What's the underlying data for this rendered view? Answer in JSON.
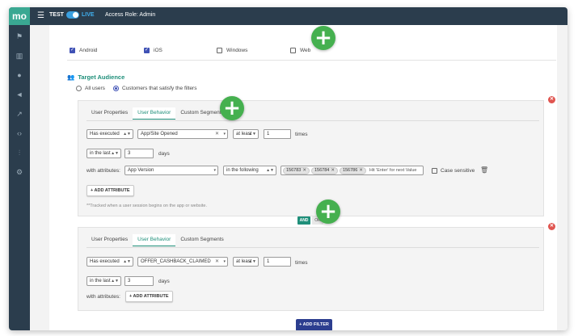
{
  "topbar": {
    "logo": "mo",
    "env_test": "TEST",
    "env_live": "LIVE",
    "access_role": "Access Role: Admin"
  },
  "sidebar": {
    "icons": [
      "flag-icon",
      "bar-chart-icon",
      "users-icon",
      "megaphone-icon",
      "trend-chart-icon",
      "code-icon",
      "sliders-icon",
      "gear-icon"
    ]
  },
  "platforms": [
    {
      "label": "Android",
      "checked": true
    },
    {
      "label": "iOS",
      "checked": true
    },
    {
      "label": "Windows",
      "checked": false
    },
    {
      "label": "Web",
      "checked": false
    }
  ],
  "target_audience": {
    "title": "Target Audience",
    "option_all": "All users",
    "option_filters": "Customers that satisfy the filters",
    "selected": "filters"
  },
  "filter1": {
    "tabs": [
      "User Properties",
      "User Behavior",
      "Custom Segments"
    ],
    "active_tab": "User Behavior",
    "action": "Has executed",
    "event": "App/Site Opened",
    "comparator": "at least",
    "count": "1",
    "count_suffix": "times",
    "period": "in the last",
    "period_value": "3",
    "period_suffix": "days",
    "with_attributes_label": "with attributes:",
    "attribute": "App Version",
    "attr_operator": "in the following",
    "tags": [
      "156783",
      "156784",
      "156786"
    ],
    "tag_placeholder": "Hit 'Enter' for next Value",
    "case_sensitive": "Case sensitive",
    "add_attribute": "+ ADD ATTRIBUTE",
    "note": "**Tracked when a user session begins on the app or website."
  },
  "connector": {
    "and": "AND",
    "or": "OR",
    "selected": "AND"
  },
  "filter2": {
    "tabs": [
      "User Properties",
      "User Behavior",
      "Custom Segments"
    ],
    "active_tab": "User Behavior",
    "action": "Has executed",
    "event": "OFFER_CASHBACK_CLAIMED",
    "comparator": "at least",
    "count": "1",
    "count_suffix": "times",
    "period": "in the last",
    "period_value": "3",
    "period_suffix": "days",
    "with_attributes_label": "with attributes:",
    "add_attribute": "+ ADD ATTRIBUTE"
  },
  "add_filter": "+ ADD FILTER",
  "colors": {
    "accent": "#1f8f7a",
    "primary_button": "#2c3e8f",
    "sidebar": "#2b3d4d",
    "plus_marker": "#45b04f",
    "remove": "#e05550"
  }
}
